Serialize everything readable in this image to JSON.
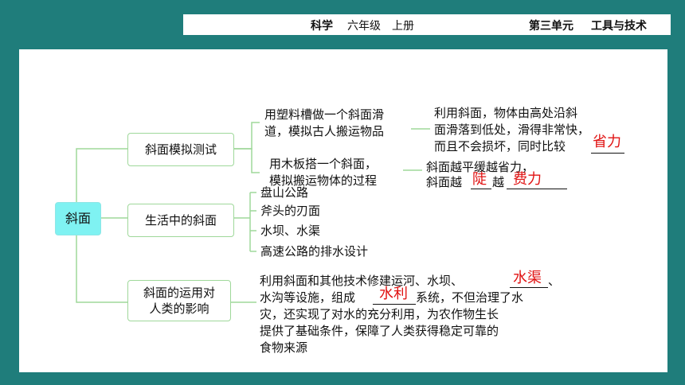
{
  "header": {
    "subject": "科学",
    "grade": "六年级",
    "volume": "上册",
    "unit": "第三单元",
    "unit_title": "工具与技术"
  },
  "root": "斜面",
  "branches": {
    "b1": "斜面模拟测试",
    "b2": "生活中的斜面",
    "b3": "斜面的运用对人类的影响"
  },
  "b1_items": {
    "i1_line1": "用塑料槽做一个斜面滑",
    "i1_line2": "道，模拟古人搬运物品",
    "i2_line1": "用木板搭一个斜面，",
    "i2_line2": "模拟搬运物体的过程",
    "r1_line1": "利用斜面，物体由高处沿斜",
    "r1_line2": "面滑落到低处，滑得非常快，",
    "r1_line3": "而且不会损坏，同时比较",
    "r2_line1": "斜面越平缓越省力，",
    "r2_line2a": "斜面越",
    "r2_line2b": "越"
  },
  "answers": {
    "a1": "省力",
    "a2": "陡",
    "a3": "费力",
    "a4": "水利",
    "a5": "水渠"
  },
  "b2_items": [
    "盘山公路",
    "斧头的刃面",
    "水坝、水渠",
    "高速公路的排水设计"
  ],
  "b3_text": {
    "l1": "利用斜面和其他技术修建运河、水坝、",
    "l1_end": "、",
    "l2a": "水沟等设施，组成",
    "l2b": "系统，不但治理了水",
    "l3": "灾，还实现了对水的充分利用，为农作物生长",
    "l4": "提供了基础条件，保障了人类获得稳定可靠的",
    "l5": "食物来源"
  }
}
